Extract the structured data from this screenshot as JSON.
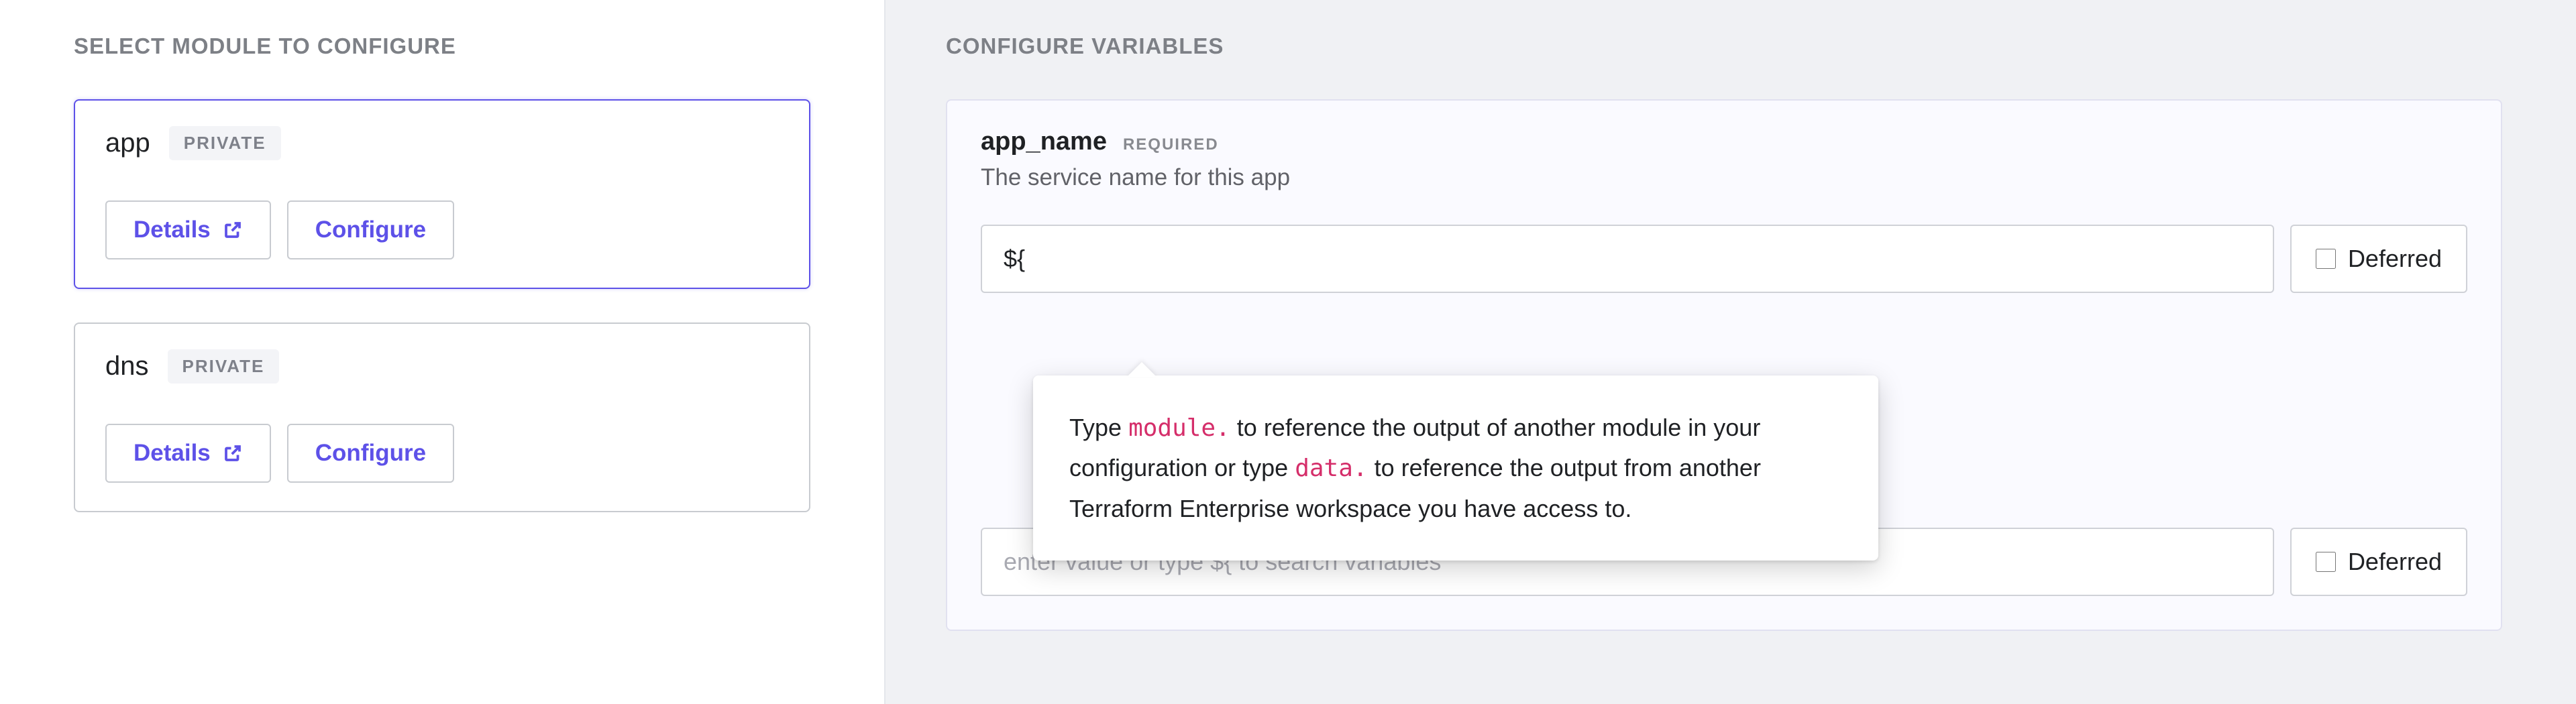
{
  "left": {
    "title": "SELECT MODULE TO CONFIGURE",
    "modules": [
      {
        "name": "app",
        "badge": "PRIVATE",
        "details": "Details",
        "configure": "Configure"
      },
      {
        "name": "dns",
        "badge": "PRIVATE",
        "details": "Details",
        "configure": "Configure"
      }
    ]
  },
  "right": {
    "title": "CONFIGURE VARIABLES",
    "var": {
      "name": "app_name",
      "required": "REQUIRED",
      "description": "The service name for this app",
      "value": "${",
      "deferred_label": "Deferred"
    },
    "hint": {
      "pre": "Type ",
      "code1": "module.",
      "mid1": " to reference the output of another module in your configuration or type ",
      "code2": "data.",
      "mid2": " to reference the output from another Terraform Enterprise workspace you have access to."
    },
    "second_input_placeholder": "enter value or type ${ to search variables",
    "deferred2_label": "Deferred"
  }
}
